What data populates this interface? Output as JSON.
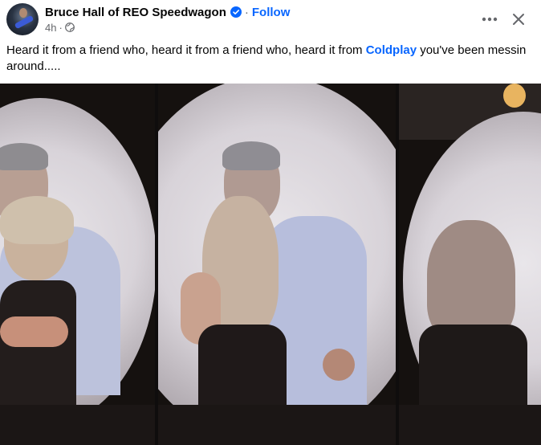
{
  "post": {
    "author": "Bruce Hall of REO Speedwagon",
    "separator": "·",
    "follow_label": "Follow",
    "time": "4h",
    "time_separator": "·",
    "privacy_icon": "globe-icon",
    "text_before": "Heard it from a friend who, heard it from a friend who, heard it from ",
    "tag": "Coldplay",
    "text_after": " you've been messin around....."
  },
  "actions": {
    "more_icon": "more-horizontal-icon",
    "close_icon": "close-icon"
  },
  "colors": {
    "accent": "#0866ff",
    "text_primary": "#050505",
    "text_secondary": "#65676b",
    "media_background": "#0f0d0d"
  },
  "media": {
    "type": "photo-collage",
    "panel_count": 3
  }
}
